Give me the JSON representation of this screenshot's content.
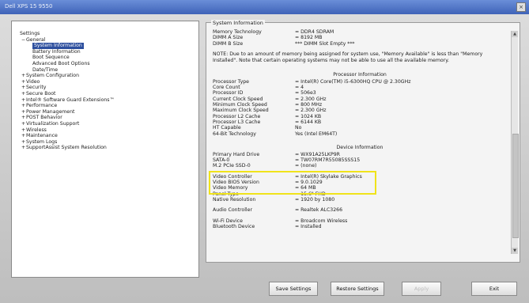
{
  "window": {
    "title": "Dell XPS 15 9550",
    "close_glyph": "×"
  },
  "tree": [
    {
      "label": "Settings",
      "indent": 0,
      "expand": ""
    },
    {
      "label": "General",
      "indent": 1,
      "expand": "−"
    },
    {
      "label": "System Information",
      "indent": 2,
      "expand": "",
      "selected": true
    },
    {
      "label": "Battery Information",
      "indent": 2,
      "expand": ""
    },
    {
      "label": "Boot Sequence",
      "indent": 2,
      "expand": ""
    },
    {
      "label": "Advanced Boot Options",
      "indent": 2,
      "expand": ""
    },
    {
      "label": "Date/Time",
      "indent": 2,
      "expand": ""
    },
    {
      "label": "System Configuration",
      "indent": 1,
      "expand": "+"
    },
    {
      "label": "Video",
      "indent": 1,
      "expand": "+"
    },
    {
      "label": "Security",
      "indent": 1,
      "expand": "+"
    },
    {
      "label": "Secure Boot",
      "indent": 1,
      "expand": "+"
    },
    {
      "label": "Intel® Software Guard Extensions™",
      "indent": 1,
      "expand": "+"
    },
    {
      "label": "Performance",
      "indent": 1,
      "expand": "+"
    },
    {
      "label": "Power Management",
      "indent": 1,
      "expand": "+"
    },
    {
      "label": "POST Behavior",
      "indent": 1,
      "expand": "+"
    },
    {
      "label": "Virtualization Support",
      "indent": 1,
      "expand": "+"
    },
    {
      "label": "Wireless",
      "indent": 1,
      "expand": "+"
    },
    {
      "label": "Maintenance",
      "indent": 1,
      "expand": "+"
    },
    {
      "label": "System Logs",
      "indent": 1,
      "expand": "+"
    },
    {
      "label": "SupportAssist System Resolution",
      "indent": 1,
      "expand": "+"
    }
  ],
  "panel": {
    "group_title": "System Information",
    "memory": [
      {
        "k": "Memory Technology",
        "v": "= DDR4 SDRAM"
      },
      {
        "k": "DIMM A Size",
        "v": "= 8192 MB"
      },
      {
        "k": "DIMM B Size",
        "v": "*** DIMM Slot Empty ***"
      }
    ],
    "note": "NOTE: Due to an amount of memory being assigned for system use, \"Memory Available\" is less than \"Memory Installed\". Note that certain operating systems may not be able to use all the available memory.",
    "processor_title": "Processor Information",
    "processor": [
      {
        "k": "Processor Type",
        "v": "= Intel(R) Core(TM) i5-6300HQ CPU @ 2.30GHz"
      },
      {
        "k": "Core Count",
        "v": "= 4"
      },
      {
        "k": "Processor ID",
        "v": "= 506e3"
      },
      {
        "k": "Current Clock Speed",
        "v": "= 2.300 GHz"
      },
      {
        "k": "Minimum Clock Speed",
        "v": "= 800 MHz"
      },
      {
        "k": "Maximum Clock Speed",
        "v": "= 2.300 GHz"
      },
      {
        "k": "Processor L2 Cache",
        "v": "= 1024 KB"
      },
      {
        "k": "Processor L3 Cache",
        "v": "= 6144 KB"
      },
      {
        "k": "HT Capable",
        "v": "No"
      },
      {
        "k": "64-Bit Technology",
        "v": "Yes (Intel EM64T)"
      }
    ],
    "device_title": "Device Information",
    "device": [
      {
        "k": "Primary Hard Drive",
        "v": "= WX91A25LKP9R"
      },
      {
        "k": "SATA-0",
        "v": "= TW07RM7R55085SSS15"
      },
      {
        "k": "M.2 PCIe SSD-0",
        "v": "= (none)"
      }
    ],
    "video": [
      {
        "k": "Video Controller",
        "v": "= Intel(R) Skylake Graphics"
      },
      {
        "k": "Video BIOS Version",
        "v": "= 9.0.1029"
      },
      {
        "k": "Video Memory",
        "v": "= 64 MB"
      },
      {
        "k": "Panel Type",
        "v": "= 15.6\" FHD"
      },
      {
        "k": "Native Resolution",
        "v": "= 1920 by 1080"
      }
    ],
    "audio": [
      {
        "k": "Audio Controller",
        "v": "= Realtek ALC3266"
      }
    ],
    "wireless": [
      {
        "k": "Wi-Fi Device",
        "v": "= Broadcom Wireless"
      },
      {
        "k": "Bluetooth Device",
        "v": "= Installed"
      }
    ]
  },
  "buttons": {
    "save": "Save Settings",
    "restore": "Restore Settings",
    "apply": "Apply",
    "exit": "Exit"
  },
  "colors": {
    "highlight": "#f0e31a",
    "selection": "#2d4f9e",
    "title_bar": "#3f63b8"
  },
  "icons": {
    "scroll_up": "▲",
    "scroll_down": "▼"
  }
}
